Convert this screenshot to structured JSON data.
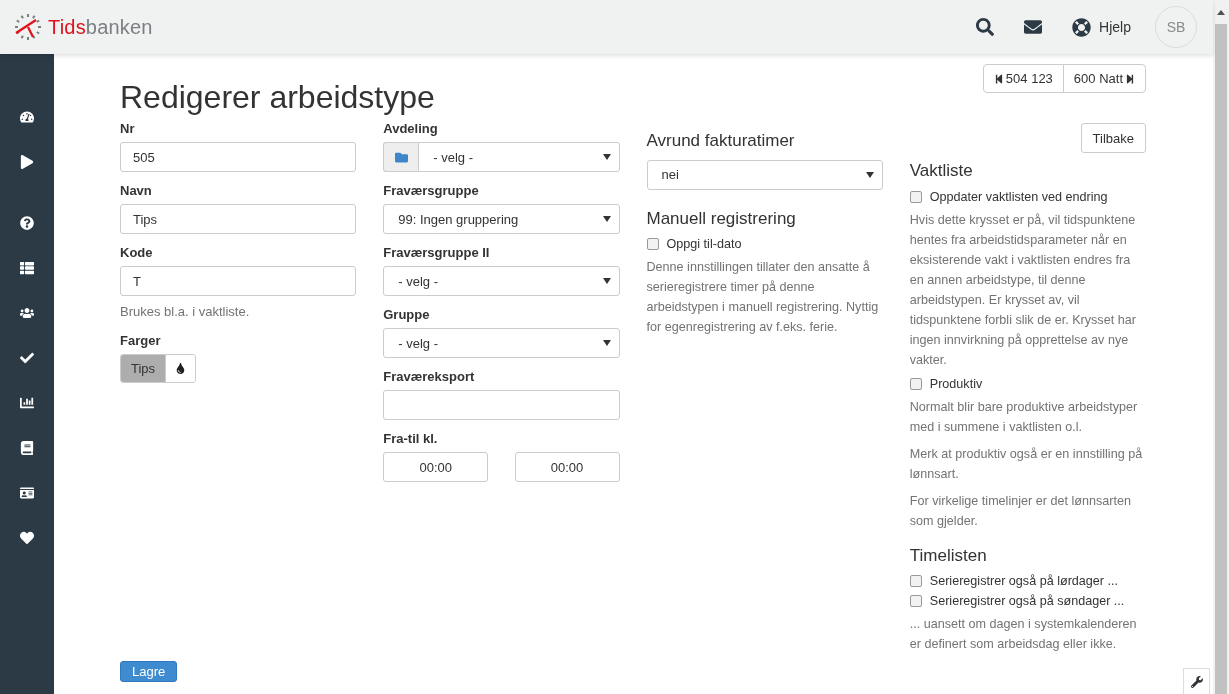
{
  "app": {
    "logo": {
      "accent": "Tids",
      "rest": "banken"
    },
    "help": "Hjelp",
    "avatar": "SB"
  },
  "nav_buttons": [
    {
      "kind": "prev",
      "label": "504 123"
    },
    {
      "kind": "next",
      "label": "600 Natt"
    }
  ],
  "title": "Redigerer arbeidstype",
  "back_button": "Tilbake",
  "column_1": [
    {
      "kind": "text",
      "label": "Nr",
      "value": "505"
    },
    {
      "kind": "text",
      "label": "Navn",
      "value": "Tips"
    },
    {
      "kind": "text",
      "label": "Kode",
      "value": "T",
      "help": "Brukes bl.a. i vaktliste."
    },
    {
      "kind": "color",
      "label": "Farger",
      "value": "Tips",
      "color": "#adadad"
    }
  ],
  "column_2": [
    {
      "kind": "select",
      "label": "Avdeling",
      "value": "- velg -",
      "addon": true
    },
    {
      "kind": "select",
      "label": "Fraværsgruppe",
      "value": "99: Ingen gruppering"
    },
    {
      "kind": "select",
      "label": "Fraværsgruppe II",
      "value": "- velg -"
    },
    {
      "kind": "select",
      "label": "Gruppe",
      "value": "- velg -"
    },
    {
      "kind": "text",
      "label": "Fraværeksport"
    },
    {
      "kind": "time_range",
      "label": "Fra-til kl.",
      "from": "00:00",
      "to": "00:00"
    }
  ],
  "column_3": [
    {
      "heading": "Avrund fakturatimer",
      "items": [
        {
          "kind": "select",
          "value": "nei"
        }
      ]
    },
    {
      "heading": "Manuell registrering",
      "items": [
        {
          "kind": "checkbox",
          "label": "Oppgi til-dato",
          "checked": false
        },
        {
          "kind": "help",
          "text": "Denne innstillingen tillater den ansatte å serieregistrere timer på denne arbeidstypen i manuell registrering. Nyttig for egenregistrering av f.eks. ferie."
        }
      ]
    }
  ],
  "column_4": [
    {
      "heading": "Vaktliste",
      "items": [
        {
          "kind": "checkbox",
          "label": "Oppdater vaktlisten ved endring",
          "checked": false
        },
        {
          "kind": "help",
          "text": "Hvis dette krysset er på, vil tidspunktene hentes fra arbeidstidsparameter når en eksisterende vakt i vaktlisten endres fra en annen arbeidstype, til denne arbeidstypen. Er krysset av, vil tidspunktene forbli slik de er. Krysset har ingen innvirkning på opprettelse av nye vakter."
        },
        {
          "kind": "checkbox",
          "label": "Produktiv",
          "checked": false
        },
        {
          "kind": "help",
          "text": "Normalt blir bare produktive arbeidstyper med i summene i vaktlisten o.l."
        },
        {
          "kind": "help",
          "text": "Merk at produktiv også er en innstilling på lønnsart."
        },
        {
          "kind": "help",
          "text": "For virkelige timelinjer er det lønnsarten som gjelder."
        }
      ]
    },
    {
      "heading": "Timelisten",
      "items": [
        {
          "kind": "checkbox",
          "label": "Serieregistrer også på lørdager ...",
          "checked": false
        },
        {
          "kind": "checkbox",
          "label": "Serieregistrer også på søndager ...",
          "checked": false
        },
        {
          "kind": "help",
          "text": "... uansett om dagen i systemkalenderen er definert som arbeidsdag eller ikke."
        }
      ]
    }
  ],
  "save_button": "Lagre"
}
